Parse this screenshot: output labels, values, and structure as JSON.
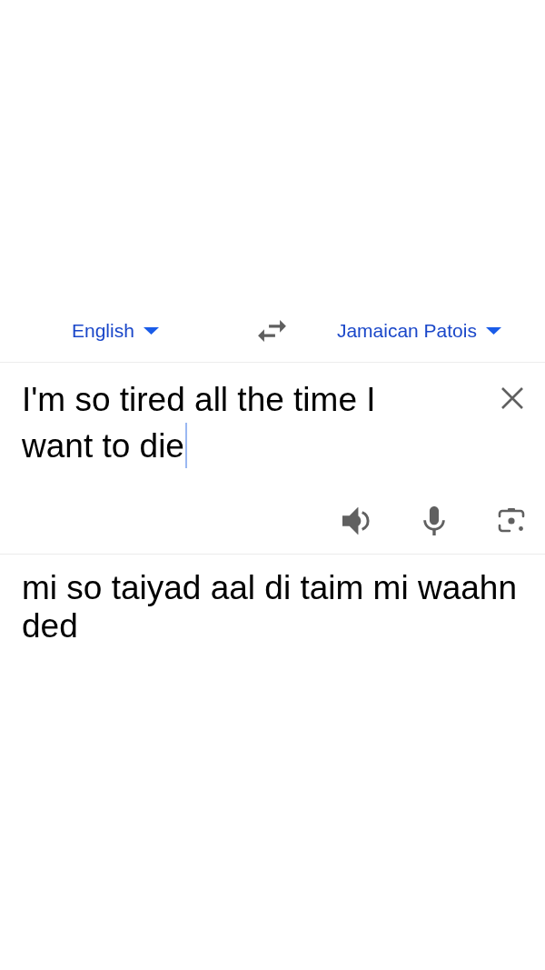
{
  "language_bar": {
    "source_language": "English",
    "target_language": "Jamaican Patois"
  },
  "input": {
    "value": "I'm so tired all the time I want to die",
    "focused": true
  },
  "output": {
    "text": "mi so taiyad aal di taim mi waahn ded"
  }
}
